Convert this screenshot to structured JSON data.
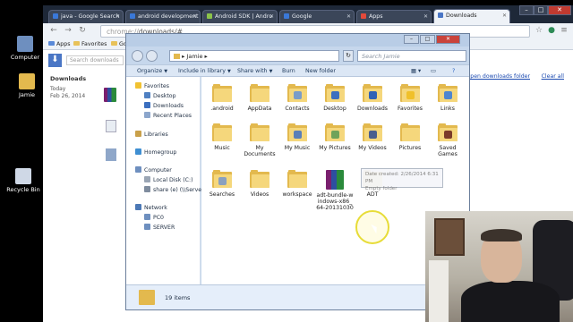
{
  "desktop": {
    "icons": [
      {
        "label": "Computer"
      },
      {
        "label": "Jamie"
      },
      {
        "label": "Recycle Bin"
      }
    ]
  },
  "chrome": {
    "tabs": [
      {
        "label": "java - Google Search",
        "color": "#3a78d8"
      },
      {
        "label": "android development",
        "color": "#3a78d8"
      },
      {
        "label": "Android SDK | Andro",
        "color": "#8bc34a"
      },
      {
        "label": "Google",
        "color": "#3a78d8"
      },
      {
        "label": "Apps",
        "color": "#e24a3b"
      },
      {
        "label": "Downloads",
        "color": "#4a76c5"
      }
    ],
    "address": {
      "scheme": "chrome://",
      "path": "downloads/#"
    },
    "bookmarks": [
      {
        "label": "Apps"
      },
      {
        "label": "Favorites"
      },
      {
        "label": "Go"
      }
    ],
    "downloads_page": {
      "search_placeholder": "Search downloads",
      "heading": "Downloads",
      "group_label": "Today",
      "group_date": "Feb 26, 2014",
      "open_folder_link": "Open downloads folder",
      "clear_all": "Clear all"
    }
  },
  "explorer": {
    "breadcrumb": "Jamie",
    "search_placeholder": "Search Jamie",
    "commands": {
      "organize": "Organize",
      "include": "Include in library",
      "share": "Share with",
      "burn": "Burn",
      "new_folder": "New folder"
    },
    "nav": {
      "favorites": "Favorites",
      "desktop": "Desktop",
      "downloads": "Downloads",
      "recent": "Recent Places",
      "libraries": "Libraries",
      "homegroup": "Homegroup",
      "computer": "Computer",
      "local_disk": "Local Disk (C:)",
      "share": "share (e) (\\\\Server) (",
      "network": "Network",
      "pc0": "PC0",
      "server": "SERVER"
    },
    "items": [
      {
        "label": ".android"
      },
      {
        "label": "AppData"
      },
      {
        "label": "Contacts"
      },
      {
        "label": "Desktop"
      },
      {
        "label": "Downloads"
      },
      {
        "label": "Favorites"
      },
      {
        "label": "Links"
      },
      {
        "label": "Music"
      },
      {
        "label": "My Documents"
      },
      {
        "label": "My Music"
      },
      {
        "label": "My Pictures"
      },
      {
        "label": "My Videos"
      },
      {
        "label": "Pictures"
      },
      {
        "label": "Saved Games"
      },
      {
        "label": "Searches"
      },
      {
        "label": "Videos"
      },
      {
        "label": "workspace"
      },
      {
        "label": "adt-bundle-windows-x86_64-20131030"
      },
      {
        "label": "ADT"
      }
    ],
    "tooltip": {
      "line1": "Date created: 2/26/2014 6:31 PM",
      "line2": "Empty folder"
    },
    "status": {
      "count": "19 items"
    }
  }
}
